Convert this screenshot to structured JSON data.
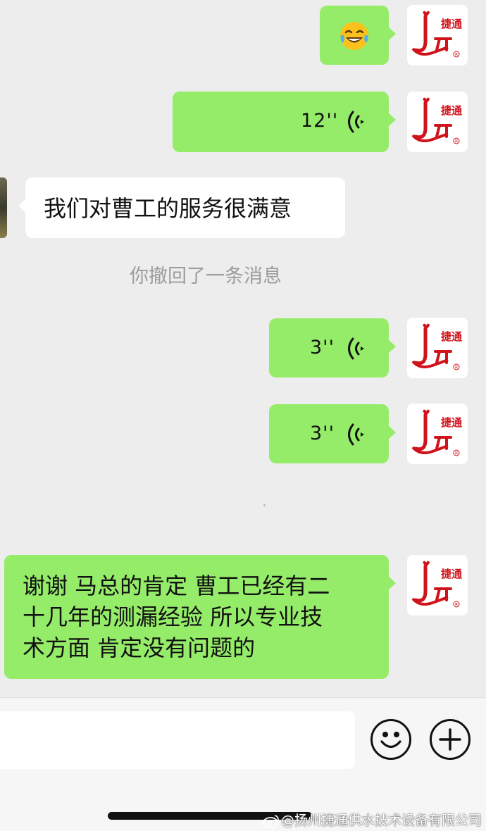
{
  "messages": [
    {
      "type": "emoji",
      "emoji_name": "face-with-tears-of-joy-emoji"
    },
    {
      "type": "voice",
      "duration": "12''"
    },
    {
      "type": "text",
      "text": "我们对曹工的服务很满意"
    },
    {
      "type": "voice",
      "duration": "3''"
    },
    {
      "type": "voice",
      "duration": "3''"
    },
    {
      "type": "text_multiline",
      "lines": [
        "谢谢 马总的肯定 曹工已经有二",
        "十几年的测漏经验 所以专业技",
        "术方面 肯定没有问题的"
      ]
    }
  ],
  "system_notice": "你撤回了一条消息",
  "avatar": {
    "brand_text": "捷通",
    "registered_mark": "®",
    "brand_color": "#d0121b"
  },
  "input": {
    "placeholder": ""
  },
  "toolbar": {
    "emoji_button": "smile-icon",
    "more_button": "plus-icon"
  },
  "watermark": "@扬州捷通供水技术设备有限公司",
  "colors": {
    "bubble_self": "#95ec69",
    "bubble_other": "#ffffff",
    "background": "#ededed"
  }
}
